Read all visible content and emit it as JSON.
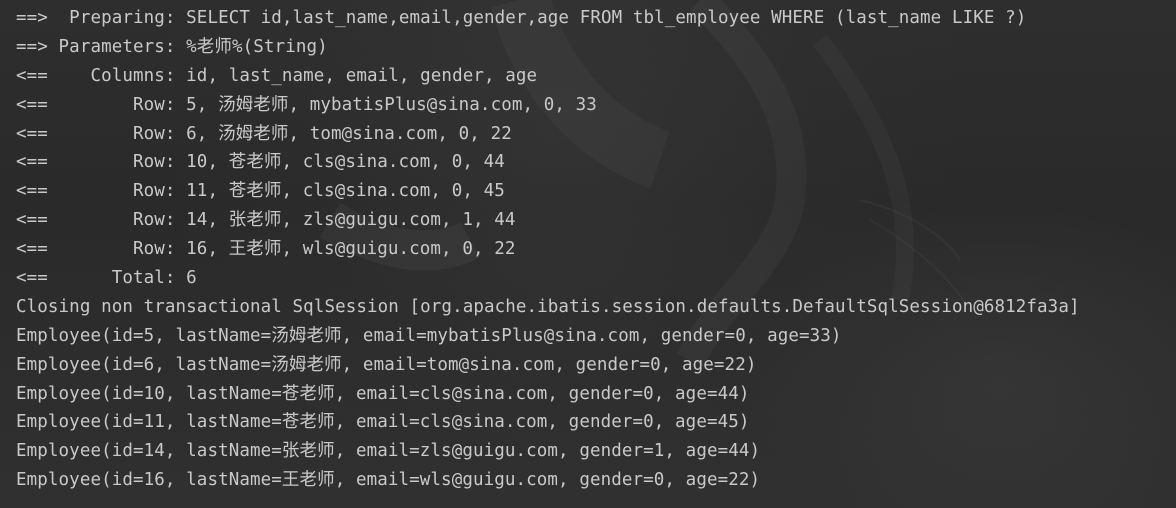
{
  "console": {
    "lines": [
      "==>  Preparing: SELECT id,last_name,email,gender,age FROM tbl_employee WHERE (last_name LIKE ?)",
      "==> Parameters: %老师%(String)",
      "<==    Columns: id, last_name, email, gender, age",
      "<==        Row: 5, 汤姆老师, mybatisPlus@sina.com, 0, 33",
      "<==        Row: 6, 汤姆老师, tom@sina.com, 0, 22",
      "<==        Row: 10, 苍老师, cls@sina.com, 0, 44",
      "<==        Row: 11, 苍老师, cls@sina.com, 0, 45",
      "<==        Row: 14, 张老师, zls@guigu.com, 1, 44",
      "<==        Row: 16, 王老师, wls@guigu.com, 0, 22",
      "<==      Total: 6",
      "Closing non transactional SqlSession [org.apache.ibatis.session.defaults.DefaultSqlSession@6812fa3a]",
      "Employee(id=5, lastName=汤姆老师, email=mybatisPlus@sina.com, gender=0, age=33)",
      "Employee(id=6, lastName=汤姆老师, email=tom@sina.com, gender=0, age=22)",
      "Employee(id=10, lastName=苍老师, email=cls@sina.com, gender=0, age=44)",
      "Employee(id=11, lastName=苍老师, email=cls@sina.com, gender=0, age=45)",
      "Employee(id=14, lastName=张老师, email=zls@guigu.com, gender=1, age=44)",
      "Employee(id=16, lastName=王老师, email=wls@guigu.com, gender=0, age=22)"
    ]
  },
  "colors": {
    "background": "#2b2b2b",
    "text": "#c9c9c9"
  }
}
